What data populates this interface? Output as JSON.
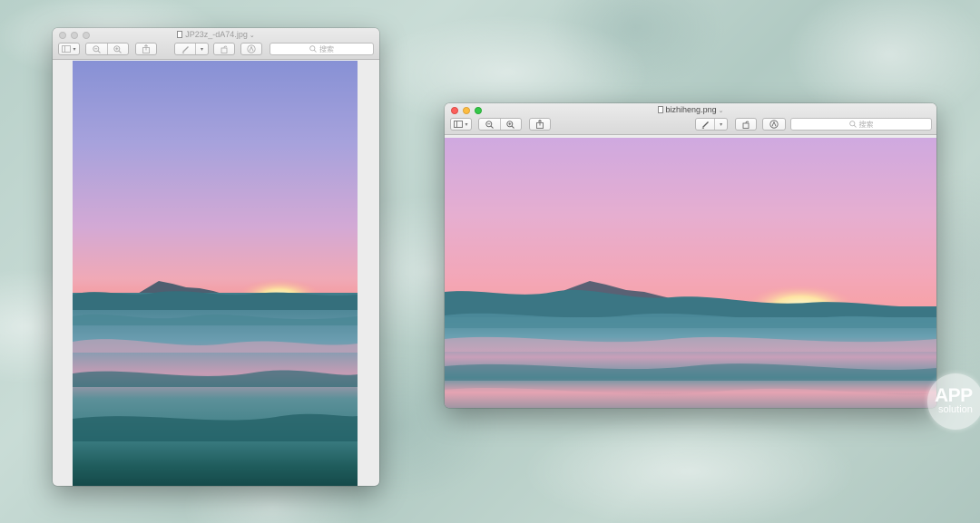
{
  "left_window": {
    "title": "JP23z_-dA74.jpg",
    "state": "inactive",
    "search_placeholder": "搜索"
  },
  "right_window": {
    "title": "bizhiheng.png",
    "state": "active",
    "search_placeholder": "搜索"
  },
  "toolbar_icons": [
    "sidebar-icon",
    "zoom-out-icon",
    "zoom-in-icon",
    "share-icon",
    "markup-pen-icon",
    "rotate-icon",
    "annotate-icon",
    "search-icon"
  ],
  "watermark": {
    "line1": "APP",
    "line2": "solution"
  },
  "colors": {
    "sky_top": "#8b96d6",
    "sky_mid": "#c9a8d8",
    "horizon": "#f2a0a6",
    "sun": "#fff6b8",
    "sea_dark": "#2f6f78",
    "sea_light": "#7fb6be",
    "red_light": "#fc605c",
    "yellow_light": "#fdbc40",
    "green_light": "#34c84a"
  }
}
